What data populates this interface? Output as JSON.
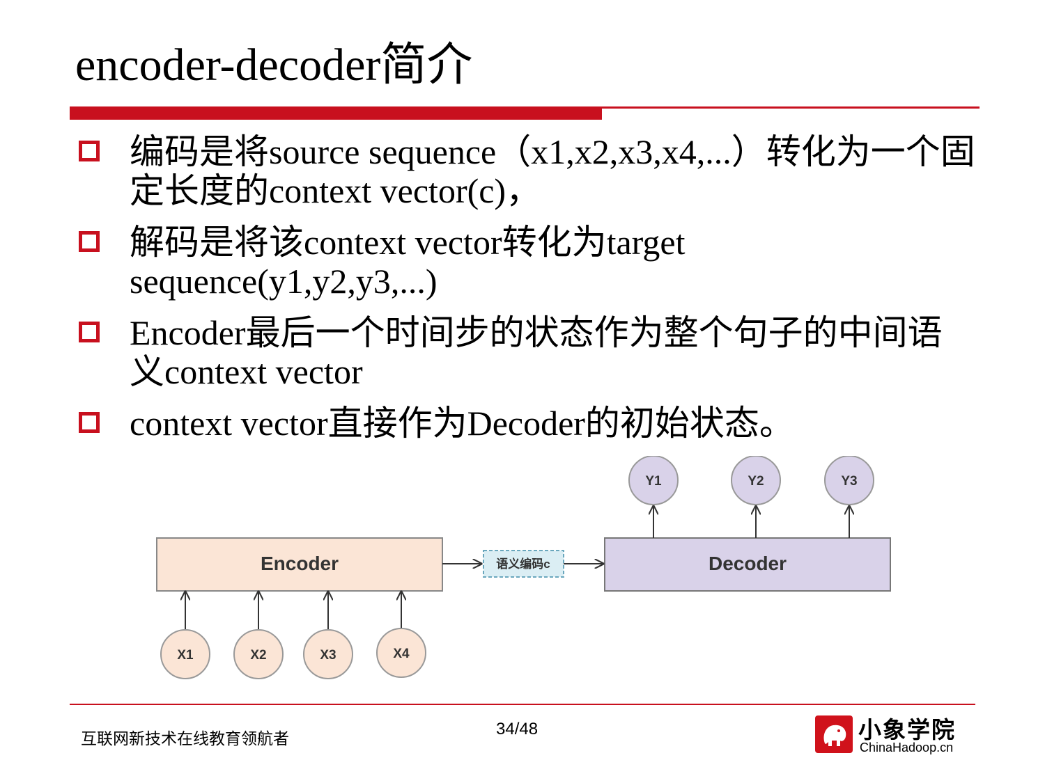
{
  "slide": {
    "title": "encoder-decoder简介",
    "bullets": [
      "编码是将source sequence（x1,x2,x3,x4,...）转化为一个固定长度的context vector(c)，",
      "解码是将该context vector转化为target sequence(y1,y2,y3,...)",
      "Encoder最后一个时间步的状态作为整个句子的中间语义context vector",
      "context vector直接作为Decoder的初始状态。"
    ]
  },
  "diagram": {
    "encoder_label": "Encoder",
    "decoder_label": "Decoder",
    "context_label": "语义编码c",
    "inputs": [
      "X1",
      "X2",
      "X3",
      "X4"
    ],
    "outputs": [
      "Y1",
      "Y2",
      "Y3"
    ],
    "colors": {
      "encoder_fill": "#fbe5d6",
      "decoder_fill": "#d9d2e9",
      "context_fill": "#dbeef4",
      "node_fill": "#fbe5d6",
      "output_node_fill": "#d9d2e9"
    }
  },
  "footer": {
    "slogan": "互联网新技术在线教育领航者",
    "page": "34/48",
    "logo_name": "小象学院",
    "logo_site": "ChinaHadoop.cn",
    "logo_icon": "elephant-icon"
  },
  "colors": {
    "accent": "#c8101e"
  }
}
